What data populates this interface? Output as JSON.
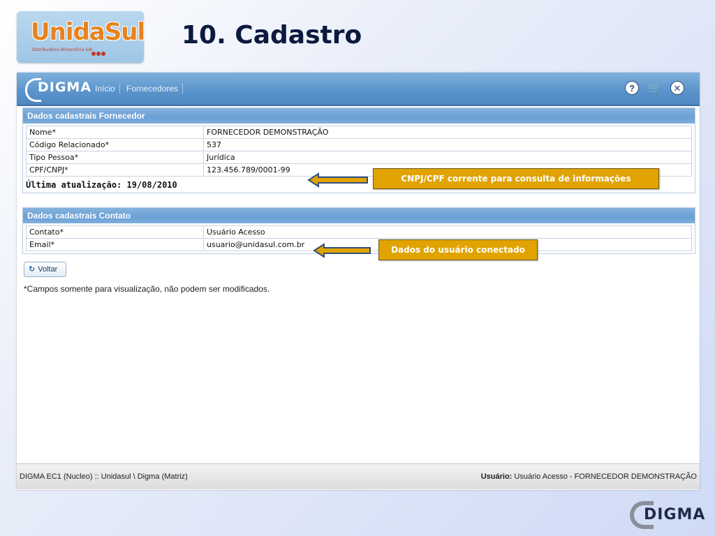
{
  "slide": {
    "title": "10. Cadastro",
    "logo_text": "UnidaSul",
    "logo_subtitle": "Distribuidora Alimentícia S/A",
    "footer_logo": "DIGMA"
  },
  "app": {
    "brand": "DIGMA",
    "nav": [
      "Início",
      "Fornecedores"
    ],
    "icons": [
      "help-icon",
      "cart-icon",
      "close-icon"
    ]
  },
  "fornecedor": {
    "header": "Dados cadastrais Fornecedor",
    "rows": [
      {
        "label": "Nome*",
        "value": "FORNECEDOR DEMONSTRAÇÃO"
      },
      {
        "label": "Código Relacionado*",
        "value": "537"
      },
      {
        "label": "Tipo Pessoa*",
        "value": "Jurídica"
      },
      {
        "label": "CPF/CNPJ*",
        "value": "123.456.789/0001-99"
      }
    ],
    "updated": "Última atualização: 19/08/2010"
  },
  "contato": {
    "header": "Dados cadastrais Contato",
    "rows": [
      {
        "label": "Contato*",
        "value": "Usuário Acesso"
      },
      {
        "label": "Email*",
        "value": "usuario@unidasul.com.br"
      }
    ]
  },
  "actions": {
    "back_label": "Voltar"
  },
  "note": "*Campos somente para visualização, não podem ser modificados.",
  "status": {
    "left": "DIGMA EC1 (Nucleo) :: Unidasul \\ Digma (Matriz)",
    "user_label": "Usuário:",
    "user_value": "Usuário Acesso - FORNECEDOR DEMONSTRAÇÃO"
  },
  "callouts": {
    "cnpj": "CNPJ/CPF corrente para consulta de informações",
    "user": "Dados do usuário conectado"
  },
  "colors": {
    "accent": "#5c95cc",
    "callout": "#e0a300",
    "title": "#0b1a3d"
  }
}
